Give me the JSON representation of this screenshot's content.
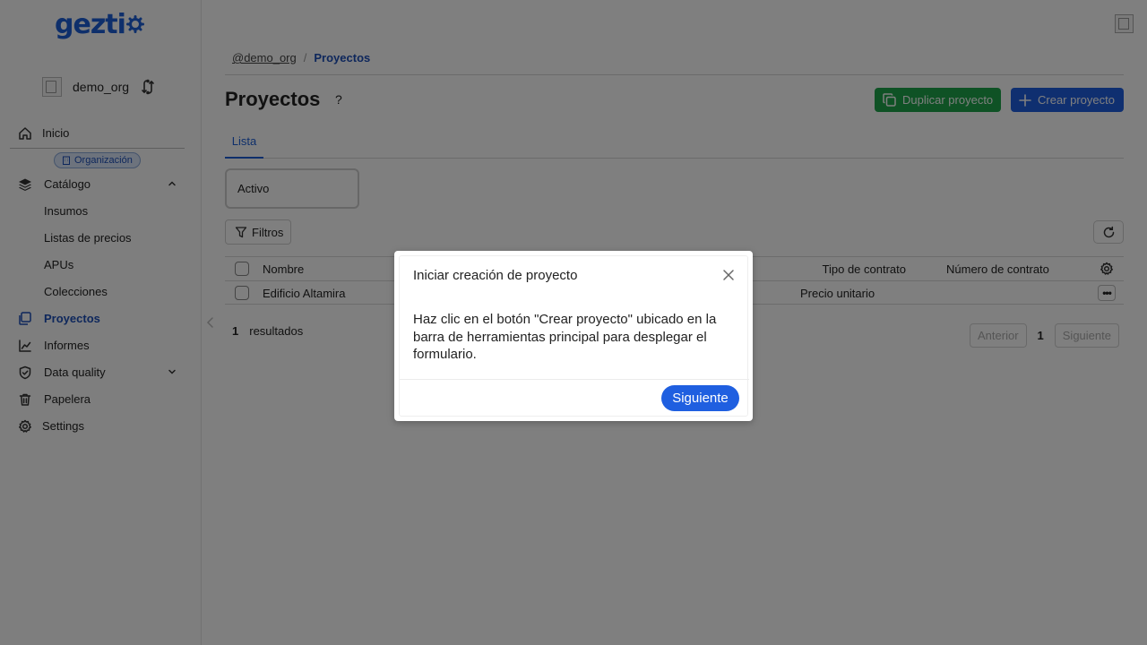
{
  "app": {
    "logo_text": "gezti"
  },
  "sidebar": {
    "org_name": "demo_org",
    "org_badge": "Organización",
    "items": [
      {
        "label": "Inicio",
        "icon": "home-icon"
      },
      {
        "label": "Catálogo",
        "icon": "layers-icon"
      },
      {
        "label": "Proyectos",
        "icon": "copy-icon"
      },
      {
        "label": "Informes",
        "icon": "chart-icon"
      },
      {
        "label": "Data quality",
        "icon": "shield-icon"
      },
      {
        "label": "Papelera",
        "icon": "trash-icon"
      },
      {
        "label": "Settings",
        "icon": "gear-icon"
      }
    ],
    "catalog_subitems": [
      "Insumos",
      "Listas de precios",
      "APUs",
      "Colecciones"
    ]
  },
  "breadcrumb": {
    "org": "@demo_org",
    "sep": "/",
    "current": "Proyectos"
  },
  "page": {
    "title": "Proyectos",
    "help": "?",
    "duplicate_label": "Duplicar proyecto",
    "create_label": "Crear proyecto",
    "tab_list": "Lista",
    "status_filter": "Activo",
    "filters_label": "Filtros"
  },
  "table": {
    "headers": {
      "name": "Nombre",
      "contract_type": "Tipo de contrato",
      "contract_number": "Número de contrato"
    },
    "rows": [
      {
        "name": "Edificio Altamira",
        "contract_type": "Precio unitario",
        "contract_number": ""
      }
    ]
  },
  "footer": {
    "count": "1",
    "results_label": "resultados",
    "prev_label": "Anterior",
    "page": "1",
    "next_label": "Siguiente"
  },
  "modal": {
    "title": "Iniciar creación de proyecto",
    "body": "Haz clic en el botón \"Crear proyecto\" ubicado en la barra de herramientas principal para desplegar el formulario.",
    "next_label": "Siguiente"
  },
  "colors": {
    "primary": "#1f5fe0",
    "success": "#1ea44a",
    "link": "#1d4fb8"
  }
}
